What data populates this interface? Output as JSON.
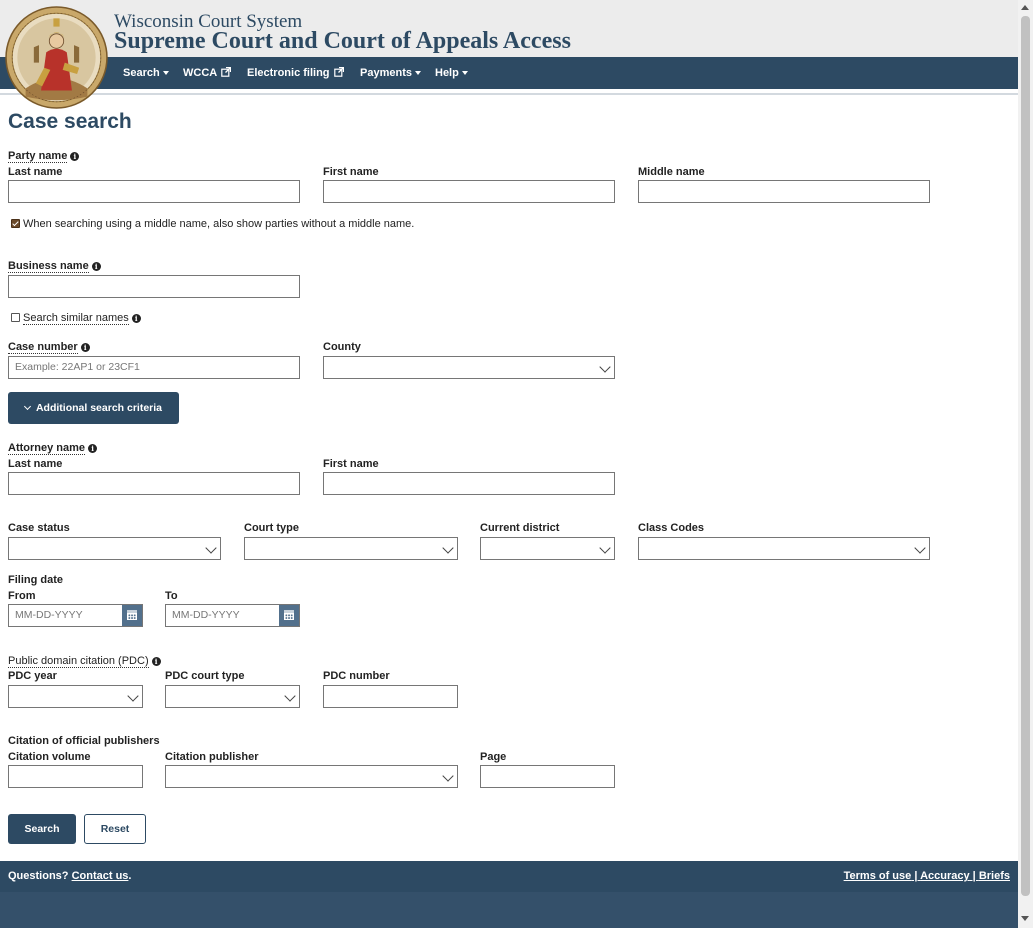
{
  "header": {
    "subtitle": "Wisconsin Court System",
    "title": "Supreme Court and Court of Appeals Access",
    "logo": "wisconsin-court-seal",
    "nav": [
      {
        "label": "Search",
        "icon": "caret-down"
      },
      {
        "label": "WCCA",
        "icon": "external-link"
      },
      {
        "label": "Electronic filing",
        "icon": "external-link"
      },
      {
        "label": "Payments",
        "icon": "caret-down"
      },
      {
        "label": "Help",
        "icon": "caret-down"
      }
    ]
  },
  "page": {
    "title": "Case search",
    "party": {
      "group_label": "Party name",
      "last_label": "Last name",
      "last_value": "",
      "first_label": "First name",
      "first_value": "",
      "middle_label": "Middle name",
      "middle_value": "",
      "middle_checkbox_label": "When searching using a middle name, also show parties without a middle name.",
      "middle_checkbox_checked": true
    },
    "business": {
      "group_label": "Business name",
      "value": "",
      "similar_label": "Search similar names",
      "similar_checked": false
    },
    "case": {
      "number_label": "Case number",
      "number_placeholder": "Example: 22AP1 or 23CF1",
      "county_label": "County",
      "county_value": ""
    },
    "additional_button": "Additional search criteria",
    "attorney": {
      "group_label": "Attorney name",
      "last_label": "Last name",
      "first_label": "First name"
    },
    "filters": {
      "case_status_label": "Case status",
      "court_type_label": "Court type",
      "current_district_label": "Current district",
      "class_codes_label": "Class Codes"
    },
    "filing": {
      "group_label": "Filing date",
      "from_label": "From",
      "to_label": "To",
      "from_placeholder": "MM-DD-YYYY",
      "to_placeholder": "MM-DD-YYYY"
    },
    "pdc": {
      "group_label": "Public domain citation (PDC)",
      "year_label": "PDC year",
      "court_type_label": "PDC court type",
      "number_label": "PDC number"
    },
    "official": {
      "group_label": "Citation of official publishers",
      "volume_label": "Citation volume",
      "publisher_label": "Citation publisher",
      "page_label": "Page"
    },
    "search_button": "Search",
    "reset_button": "Reset"
  },
  "footer": {
    "questions_text": "Questions?",
    "contact_link": "Contact us",
    "contact_suffix": ".",
    "terms_link": "Terms of use",
    "accuracy_link": "Accuracy",
    "briefs_link": "Briefs",
    "separator": " | "
  },
  "colors": {
    "brand": "#2d4a63",
    "header_bg": "#ececec",
    "checkbox_checked": "#6b4a2a"
  }
}
